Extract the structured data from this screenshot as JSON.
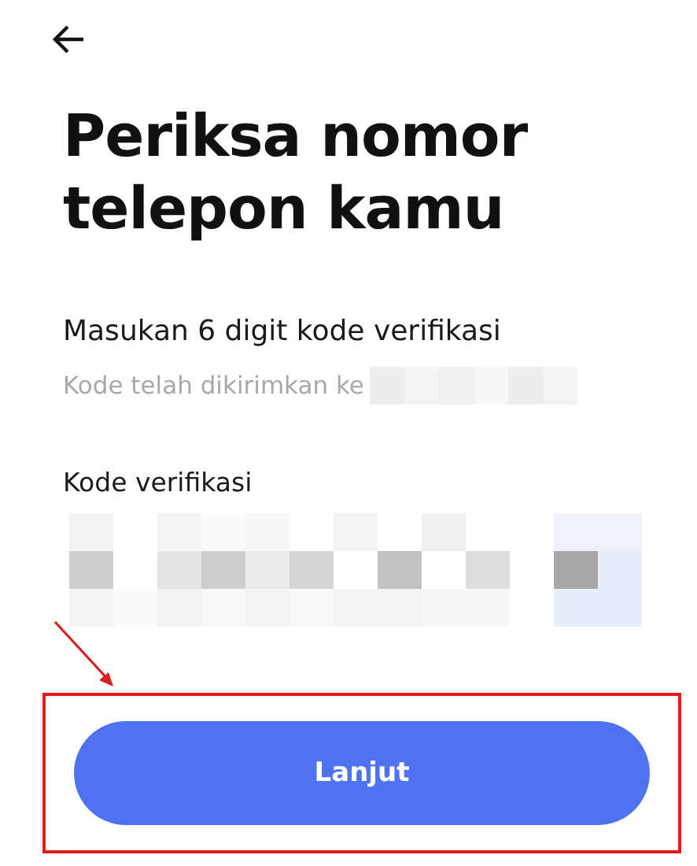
{
  "title": "Periksa nomor telepon kamu",
  "instruction": "Masukan 6 digit kode verifikasi",
  "sent_note": "Kode telah dikirimkan ke",
  "code_field": {
    "label": "Kode verifikasi"
  },
  "button": {
    "label": "Lanjut",
    "highlighted": true
  }
}
